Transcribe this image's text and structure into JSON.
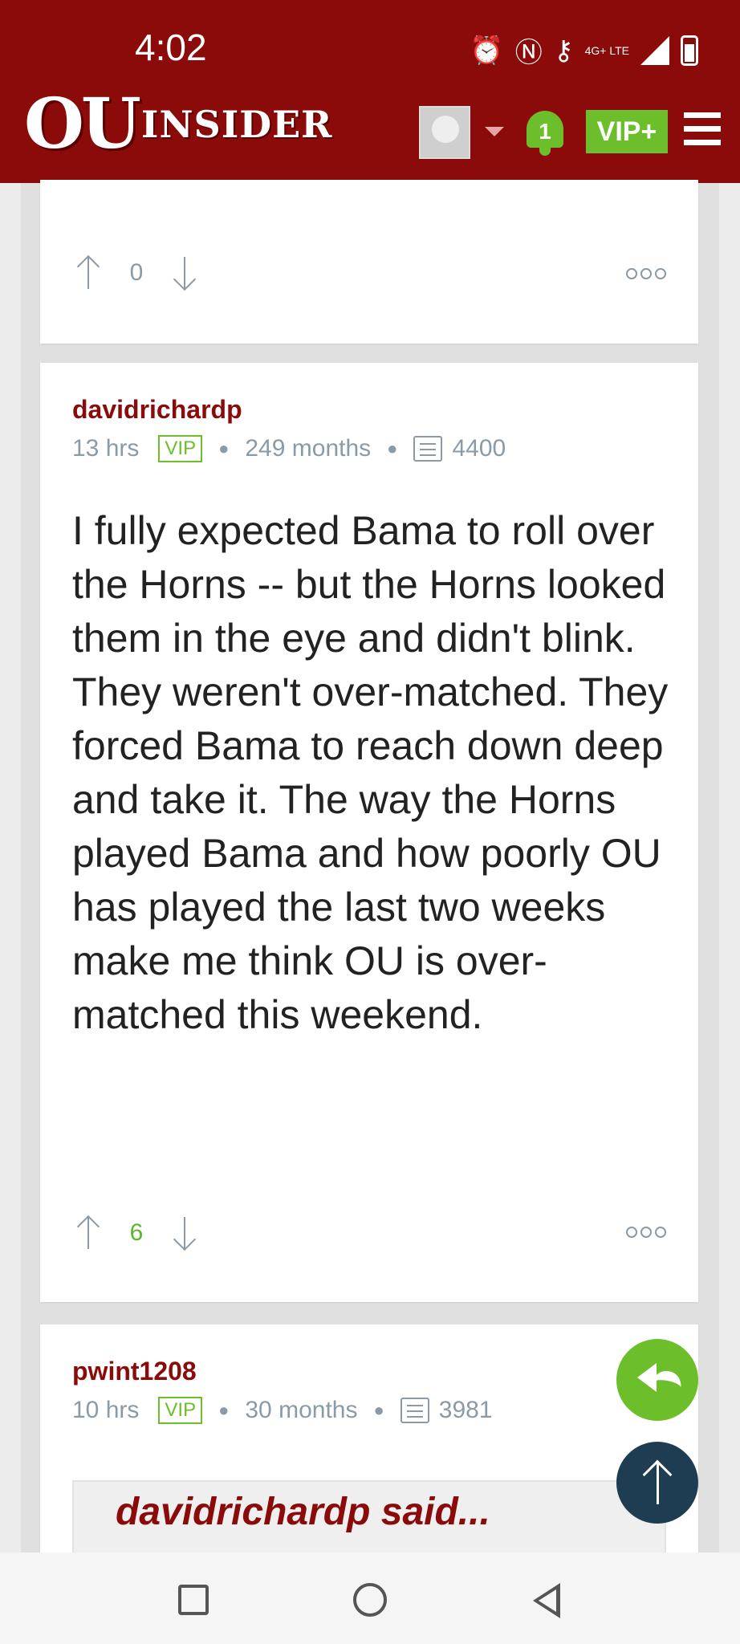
{
  "status_bar": {
    "time": "4:02",
    "network": "4G+ LTE"
  },
  "header": {
    "logo_primary": "OU",
    "logo_secondary": "INSIDER",
    "notifications_count": "1",
    "vip_label": "VIP+"
  },
  "posts": [
    {
      "votes": "0"
    },
    {
      "author": "davidrichardp",
      "time": "13 hrs",
      "badge": "VIP",
      "tenure": "249 months",
      "post_count": "4400",
      "body": "I fully expected Bama to roll over the Horns -- but the Horns looked them in the eye and didn't blink. They weren't over-matched. They forced Bama to reach down deep and take it. The way the Horns played Bama and how poorly OU has played the last two weeks make me think OU is over-matched this weekend.",
      "votes": "6"
    },
    {
      "author": "pwint1208",
      "time": "10 hrs",
      "badge": "VIP",
      "tenure": "30 months",
      "post_count": "3981",
      "quote_author": "davidrichardp said..."
    }
  ],
  "colors": {
    "brand": "#8b0a0a",
    "accent": "#6cbf2a",
    "fab_dark": "#1f3d52"
  }
}
